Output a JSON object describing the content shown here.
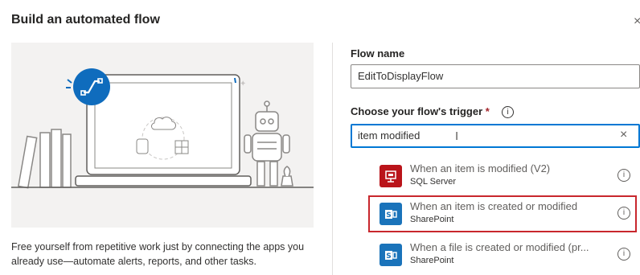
{
  "dialog": {
    "title": "Build an automated flow",
    "close_glyph": "×"
  },
  "description": "Free yourself from repetitive work just by connecting the apps you already use—automate alerts, reports, and other tasks.",
  "flow_name": {
    "label": "Flow name",
    "value": "EditToDisplayFlow"
  },
  "trigger": {
    "label": "Choose your flow's trigger",
    "required_mark": "*",
    "search_value": "item modified",
    "clear_glyph": "×"
  },
  "results": [
    {
      "title": "When an item is modified (V2)",
      "connector": "SQL Server",
      "icon": "sql-server-icon",
      "color": "#ba141a",
      "selected": false
    },
    {
      "title": "When an item is created or modified",
      "connector": "SharePoint",
      "icon": "sharepoint-icon",
      "color": "#1a73ba",
      "selected": true
    },
    {
      "title": "When a file is created or modified (pr...",
      "connector": "SharePoint",
      "icon": "sharepoint-icon",
      "color": "#1a73ba",
      "selected": false
    }
  ],
  "colors": {
    "accent": "#0078d4",
    "selection_border": "#c8272d"
  }
}
